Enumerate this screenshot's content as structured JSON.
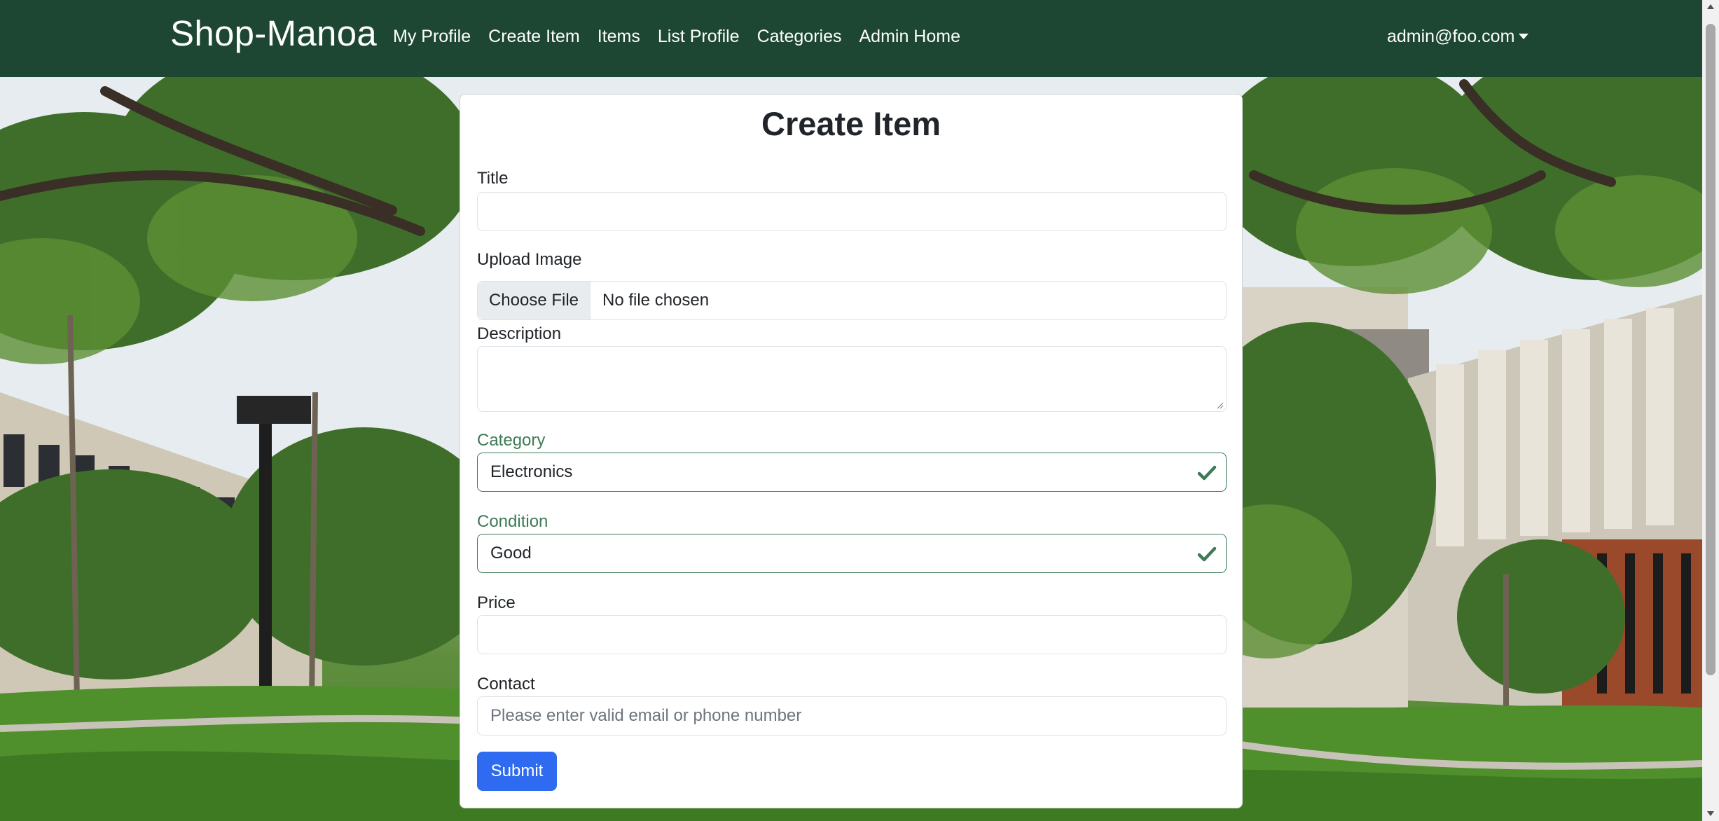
{
  "navbar": {
    "brand": "Shop-Manoa",
    "links": [
      "My Profile",
      "Create Item",
      "Items",
      "List Profile",
      "Categories",
      "Admin Home"
    ],
    "user": "admin@foo.com"
  },
  "form": {
    "title": "Create Item",
    "fields": {
      "title": {
        "label": "Title",
        "value": ""
      },
      "upload": {
        "label": "Upload Image",
        "button": "Choose File",
        "status": "No file chosen"
      },
      "description": {
        "label": "Description",
        "value": ""
      },
      "category": {
        "label": "Category",
        "value": "Electronics"
      },
      "condition": {
        "label": "Condition",
        "value": "Good"
      },
      "price": {
        "label": "Price",
        "value": ""
      },
      "contact": {
        "label": "Contact",
        "placeholder": "Please enter valid email or phone number"
      }
    },
    "submit_label": "Submit"
  },
  "colors": {
    "navbar": "#1d4732",
    "valid": "#3d7a56",
    "primary": "#2f6bf0"
  }
}
